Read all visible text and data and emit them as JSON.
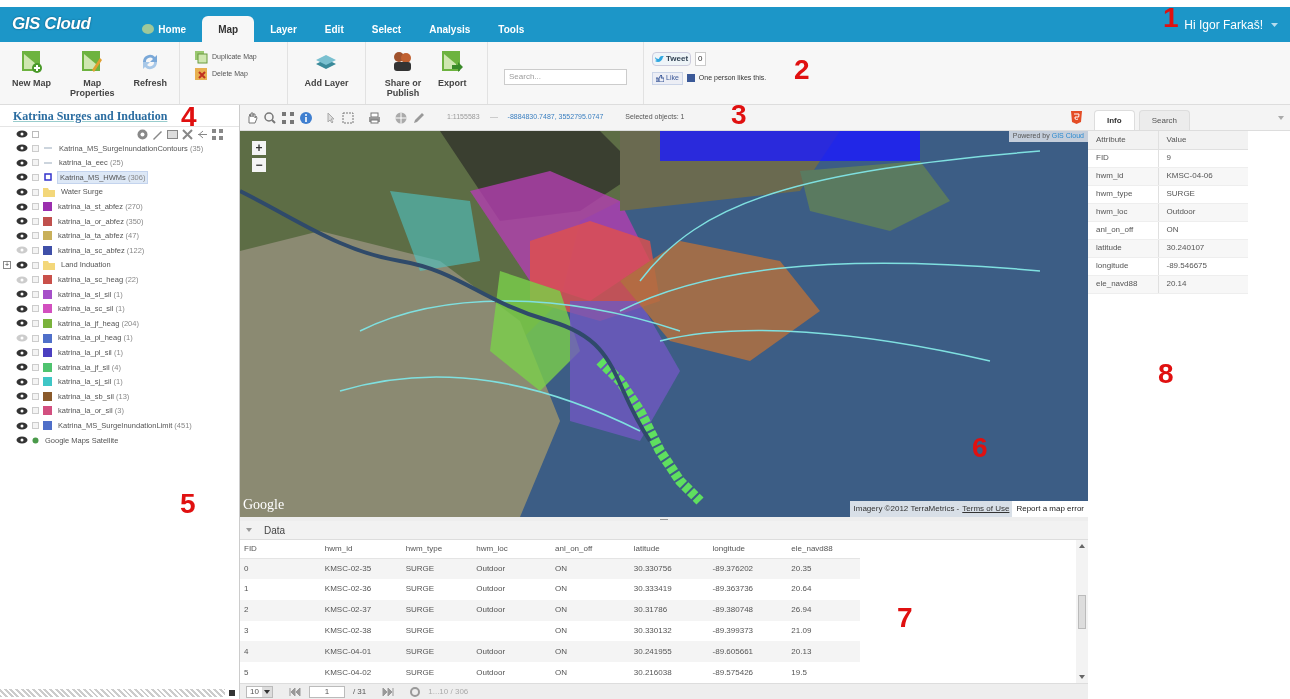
{
  "header": {
    "logo": "GIS Cloud",
    "tabs": [
      {
        "label": "Home",
        "selected": false
      },
      {
        "label": "Map",
        "selected": true
      },
      {
        "label": "Layer",
        "selected": false
      },
      {
        "label": "Edit",
        "selected": false
      },
      {
        "label": "Select",
        "selected": false
      },
      {
        "label": "Analysis",
        "selected": false
      },
      {
        "label": "Tools",
        "selected": false
      }
    ],
    "user": "Hi Igor Farkaš!"
  },
  "ribbon": {
    "big_buttons": [
      {
        "label": "New Map"
      },
      {
        "label": "Map Properties"
      },
      {
        "label": "Refresh"
      }
    ],
    "small_buttons": [
      {
        "label": "Duplicate Map"
      },
      {
        "label": "Delete Map"
      }
    ],
    "big_buttons_2": [
      {
        "label": "Add Layer"
      },
      {
        "label": "Share or Publish"
      },
      {
        "label": "Export"
      }
    ],
    "search": {
      "placeholder": "Search..."
    },
    "tweet": {
      "label": "Tweet",
      "count": "0"
    },
    "like": {
      "label": "Like",
      "text": "One person likes this."
    }
  },
  "layers_panel": {
    "title": "Katrina Surges and Induation",
    "all_checked": false,
    "items": [
      {
        "kind": "line",
        "name": "Katrina_MS_SurgeInundationContours",
        "count": "(35)",
        "visible": true,
        "checked": false,
        "selected": false
      },
      {
        "kind": "line",
        "name": "katrina_la_eec",
        "count": "(25)",
        "visible": true,
        "checked": false,
        "selected": false
      },
      {
        "kind": "point",
        "name": "Katrina_MS_HWMs",
        "count": "(306)",
        "visible": true,
        "checked": false,
        "selected": true
      },
      {
        "kind": "folder",
        "name": "Water Surge",
        "visible": true,
        "checked": false,
        "selected": false
      },
      {
        "kind": "polygon",
        "name": "katrina_la_st_abfez",
        "count": "(270)",
        "visible": true,
        "checked": false,
        "selected": false,
        "color": "#9b2fae"
      },
      {
        "kind": "polygon",
        "name": "katrina_la_or_abfez",
        "count": "(350)",
        "visible": true,
        "checked": false,
        "selected": false,
        "color": "#c0504d"
      },
      {
        "kind": "polygon",
        "name": "katrina_la_ta_abfez",
        "count": "(47)",
        "visible": true,
        "checked": false,
        "selected": false,
        "color": "#c9b05a"
      },
      {
        "kind": "polygon",
        "name": "katrina_la_sc_abfez",
        "count": "(122)",
        "visible": false,
        "checked": false,
        "selected": false,
        "color": "#3f4fa8"
      },
      {
        "kind": "folder",
        "name": "Land Induation",
        "visible": true,
        "checked": false,
        "selected": false,
        "expander": "+"
      },
      {
        "kind": "polygon",
        "name": "katrina_la_sc_heag",
        "count": "(22)",
        "visible": false,
        "checked": false,
        "selected": false,
        "color": "#c9504a"
      },
      {
        "kind": "polygon",
        "name": "katrina_la_sl_sil",
        "count": "(1)",
        "visible": true,
        "checked": false,
        "selected": false,
        "color": "#a64fc9"
      },
      {
        "kind": "polygon",
        "name": "katrina_la_sc_sil",
        "count": "(1)",
        "visible": true,
        "checked": false,
        "selected": false,
        "color": "#d24fbf"
      },
      {
        "kind": "polygon",
        "name": "katrina_la_jf_heag",
        "count": "(204)",
        "visible": true,
        "checked": false,
        "selected": false,
        "color": "#7ab33c"
      },
      {
        "kind": "polygon",
        "name": "katrina_la_pl_heag",
        "count": "(1)",
        "visible": false,
        "checked": false,
        "selected": false,
        "color": "#4f6fc9"
      },
      {
        "kind": "polygon",
        "name": "katrina_la_pl_sil",
        "count": "(1)",
        "visible": true,
        "checked": false,
        "selected": false,
        "color": "#4b3fc0"
      },
      {
        "kind": "polygon",
        "name": "katrina_la_jf_sil",
        "count": "(4)",
        "visible": true,
        "checked": false,
        "selected": false,
        "color": "#4fc36f"
      },
      {
        "kind": "polygon",
        "name": "katrina_la_sj_sil",
        "count": "(1)",
        "visible": true,
        "checked": false,
        "selected": false,
        "color": "#3fc6c6"
      },
      {
        "kind": "polygon",
        "name": "katrina_la_sb_sil",
        "count": "(13)",
        "visible": true,
        "checked": false,
        "selected": false,
        "color": "#8a5a2b"
      },
      {
        "kind": "polygon",
        "name": "katrina_la_or_sil",
        "count": "(3)",
        "visible": true,
        "checked": false,
        "selected": false,
        "color": "#d24f7f"
      },
      {
        "kind": "polygon",
        "name": "Katrina_MS_SurgeInundationLimit",
        "count": "(451)",
        "visible": true,
        "checked": false,
        "selected": false,
        "color": "#4f6fc9"
      },
      {
        "kind": "basemap",
        "name": "Google Maps Satellite",
        "visible": true,
        "selected": false
      }
    ]
  },
  "map_toolbar": {
    "scale": "1:1155583",
    "coords": "-8884830.7487, 3552795.0747",
    "selected": "Selected objects: 1"
  },
  "map": {
    "powered": "Powered by",
    "powered_link": "GIS Cloud",
    "zoom_in": "+",
    "zoom_out": "−",
    "google": "Google",
    "imagery": "Imagery ©2012 TerraMetrics -",
    "terms": "Terms of Use",
    "report": "Report a map error"
  },
  "data_panel": {
    "title": "Data",
    "columns": [
      "FID",
      "hwm_id",
      "hwm_type",
      "hwm_loc",
      "anl_on_off",
      "latitude",
      "longitude",
      "ele_navd88"
    ],
    "rows": [
      [
        "0",
        "KMSC-02-35",
        "SURGE",
        "Outdoor",
        "ON",
        "30.330756",
        "-89.376202",
        "20.35"
      ],
      [
        "1",
        "KMSC-02-36",
        "SURGE",
        "Outdoor",
        "ON",
        "30.333419",
        "-89.363736",
        "20.64"
      ],
      [
        "2",
        "KMSC-02-37",
        "SURGE",
        "Outdoor",
        "ON",
        "30.31786",
        "-89.380748",
        "26.94"
      ],
      [
        "3",
        "KMSC-02-38",
        "SURGE",
        null,
        "ON",
        "30.330132",
        "-89.399373",
        "21.09"
      ],
      [
        "4",
        "KMSC-04-01",
        "SURGE",
        "Outdoor",
        "ON",
        "30.241955",
        "-89.605661",
        "20.13"
      ],
      [
        "5",
        "KMSC-04-02",
        "SURGE",
        "Outdoor",
        "ON",
        "30.216038",
        "-89.575426",
        "19.5"
      ]
    ],
    "pager": {
      "page_size": "10",
      "page": "1",
      "pages": "/ 31",
      "range": "1...10 / 306"
    }
  },
  "info_panel": {
    "tabs": [
      {
        "label": "Info",
        "selected": true
      },
      {
        "label": "Search",
        "selected": false
      }
    ],
    "columns": [
      "Attribute",
      "Value"
    ],
    "rows": [
      [
        "FID",
        "9"
      ],
      [
        "hwm_id",
        "KMSC-04-06"
      ],
      [
        "hwm_type",
        "SURGE"
      ],
      [
        "hwm_loc",
        "Outdoor"
      ],
      [
        "anl_on_off",
        "ON"
      ],
      [
        "latitude",
        "30.240107"
      ],
      [
        "longitude",
        "-89.546675"
      ],
      [
        "ele_navd88",
        "20.14"
      ]
    ]
  },
  "annotations": [
    "1",
    "2",
    "3",
    "4",
    "5",
    "6",
    "7",
    "8"
  ]
}
